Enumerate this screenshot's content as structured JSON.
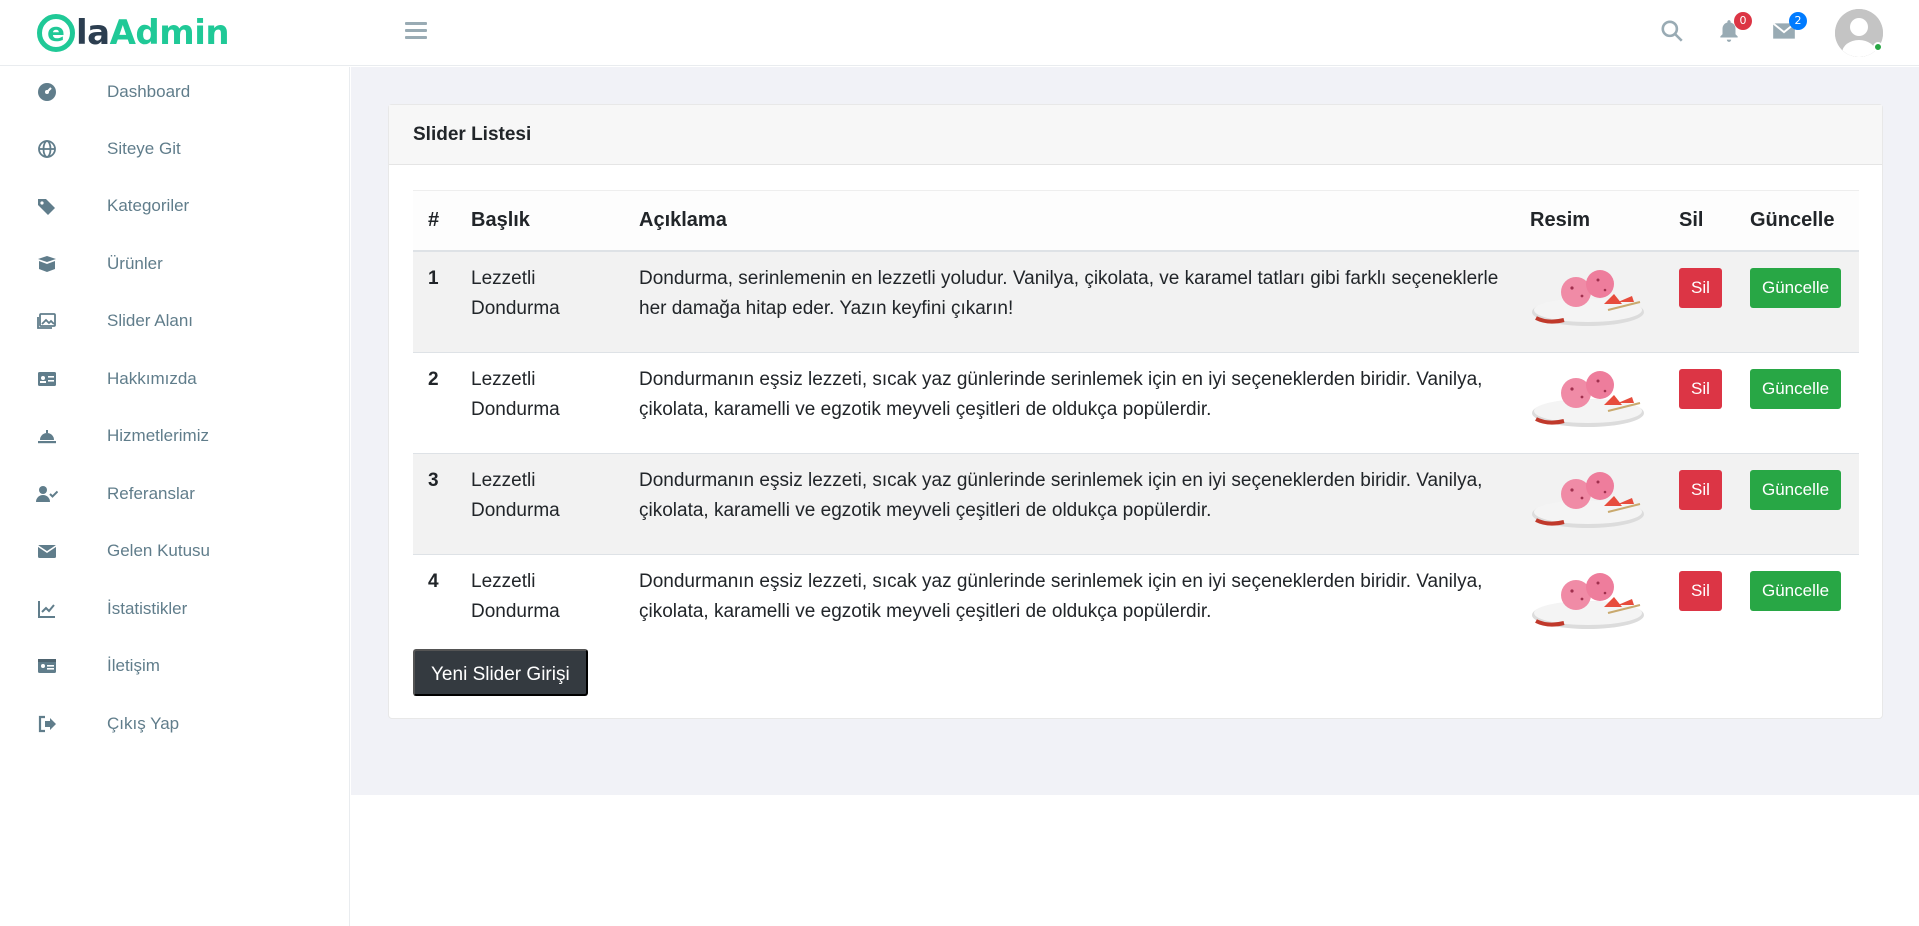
{
  "logo": {
    "initial": "e",
    "part1": "la",
    "part2": "Admin"
  },
  "header": {
    "notifications_count": "0",
    "messages_count": "2"
  },
  "sidebar": {
    "items": [
      {
        "label": "Dashboard",
        "icon": "dashboard-icon"
      },
      {
        "label": "Siteye Git",
        "icon": "globe-icon"
      },
      {
        "label": "Kategoriler",
        "icon": "tags-icon"
      },
      {
        "label": "Ürünler",
        "icon": "box-icon"
      },
      {
        "label": "Slider Alanı",
        "icon": "images-icon"
      },
      {
        "label": "Hakkımızda",
        "icon": "id-card-icon"
      },
      {
        "label": "Hizmetlerimiz",
        "icon": "concierge-bell-icon"
      },
      {
        "label": "Referanslar",
        "icon": "user-check-icon"
      },
      {
        "label": "Gelen Kutusu",
        "icon": "envelope-icon"
      },
      {
        "label": "İstatistikler",
        "icon": "chart-line-icon"
      },
      {
        "label": "İletişim",
        "icon": "address-card-icon"
      },
      {
        "label": "Çıkış Yap",
        "icon": "sign-out-icon"
      }
    ]
  },
  "card": {
    "title": "Slider Listesi"
  },
  "table": {
    "headers": {
      "num": "#",
      "title": "Başlık",
      "desc": "Açıklama",
      "image": "Resim",
      "delete": "Sil",
      "update": "Güncelle"
    },
    "rows": [
      {
        "num": "1",
        "title": "Lezzetli Dondurma",
        "desc": "Dondurma, serinlemenin en lezzetli yoludur. Vanilya, çikolata, ve karamel tatları gibi farklı seçeneklerle her damağa hitap eder. Yazın keyfini çıkarın!",
        "delete": "Sil",
        "update": "Güncelle"
      },
      {
        "num": "2",
        "title": "Lezzetli Dondurma",
        "desc": "Dondurmanın eşsiz lezzeti, sıcak yaz günlerinde serinlemek için en iyi seçeneklerden biridir. Vanilya, çikolata, karamelli ve egzotik meyveli çeşitleri de oldukça popülerdir.",
        "delete": "Sil",
        "update": "Güncelle"
      },
      {
        "num": "3",
        "title": "Lezzetli Dondurma",
        "desc": "Dondurmanın eşsiz lezzeti, sıcak yaz günlerinde serinlemek için en iyi seçeneklerden biridir. Vanilya, çikolata, karamelli ve egzotik meyveli çeşitleri de oldukça popülerdir.",
        "delete": "Sil",
        "update": "Güncelle"
      },
      {
        "num": "4",
        "title": "Lezzetli Dondurma",
        "desc": "Dondurmanın eşsiz lezzeti, sıcak yaz günlerinde serinlemek için en iyi seçeneklerden biridir. Vanilya, çikolata, karamelli ve egzotik meyveli çeşitleri de oldukça popülerdir.",
        "delete": "Sil",
        "update": "Güncelle"
      }
    ]
  },
  "new_button": "Yeni Slider Girişi",
  "colors": {
    "accent": "#20c997",
    "danger": "#dc3545",
    "success": "#28a745",
    "dark": "#343a40"
  }
}
